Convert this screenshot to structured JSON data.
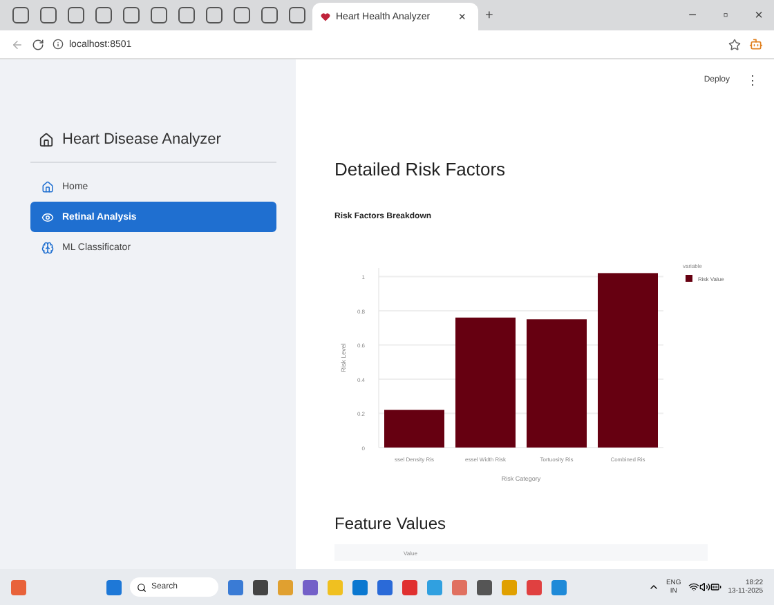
{
  "browser": {
    "active_tab": {
      "title": "Heart Health Analyzer",
      "close": "×"
    },
    "new_tab": "+",
    "address": "localhost:8501",
    "window_controls": [
      "−",
      "▫",
      "×"
    ]
  },
  "app": {
    "deploy": "Deploy",
    "menu": "⋮"
  },
  "sidebar": {
    "title": "Heart Disease Analyzer",
    "items": [
      {
        "label": "Home",
        "selected": false
      },
      {
        "label": "Retinal Analysis",
        "selected": true
      },
      {
        "label": "ML Classificator",
        "selected": false
      }
    ]
  },
  "main": {
    "heading": "Detailed Risk Factors",
    "chart_title": "Risk Factors Breakdown",
    "chart_data": {
      "type": "bar",
      "xlabel": "Risk Category",
      "ylabel": "Risk Level",
      "categories": [
        "ssel Density Ris",
        "essel Width Risk",
        "Tortuosity Ris",
        "Combined Ris"
      ],
      "series": [
        {
          "name": "Risk Value",
          "color": "#660011",
          "values": [
            0.22,
            0.76,
            0.75,
            1.02
          ]
        }
      ],
      "grid": true,
      "ylim": [
        0,
        1.05
      ],
      "yticks": [
        0,
        0.2,
        0.4,
        0.6,
        0.8,
        1
      ],
      "legend_title": "variable"
    },
    "section2": "Feature Values",
    "table_header": "Value"
  },
  "taskbar": {
    "search": "Search",
    "lang": "ENG",
    "region": "IN",
    "time": "18:22",
    "date": "13-11-2025"
  }
}
